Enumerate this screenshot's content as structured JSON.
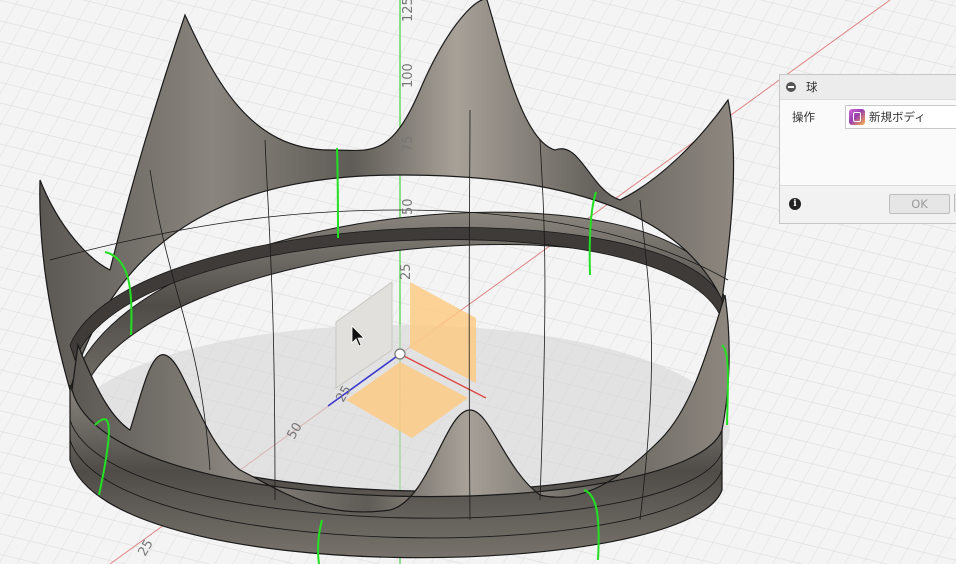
{
  "viewport": {
    "axis_labels": [
      "125",
      "100",
      "75",
      "50",
      "25",
      "25",
      "50",
      "25"
    ],
    "colors": {
      "background": "#f4f4f4",
      "grid": "#dcdcdc",
      "crown_body": "#6b6762",
      "crown_highlight": "#bdb8b0",
      "edge_lines": "#1a1a1a",
      "selected_edges": "#22e022",
      "y_axis": "#46d046",
      "x_axis": "#e04848",
      "z_axis": "#3a3ad0",
      "origin_plane_orange": "#ffc980",
      "origin_plane_grey": "#e2e0dc"
    }
  },
  "dialog": {
    "title": "球",
    "operation_label": "操作",
    "operation_value": "新規ボディ",
    "ok_label": "OK"
  }
}
